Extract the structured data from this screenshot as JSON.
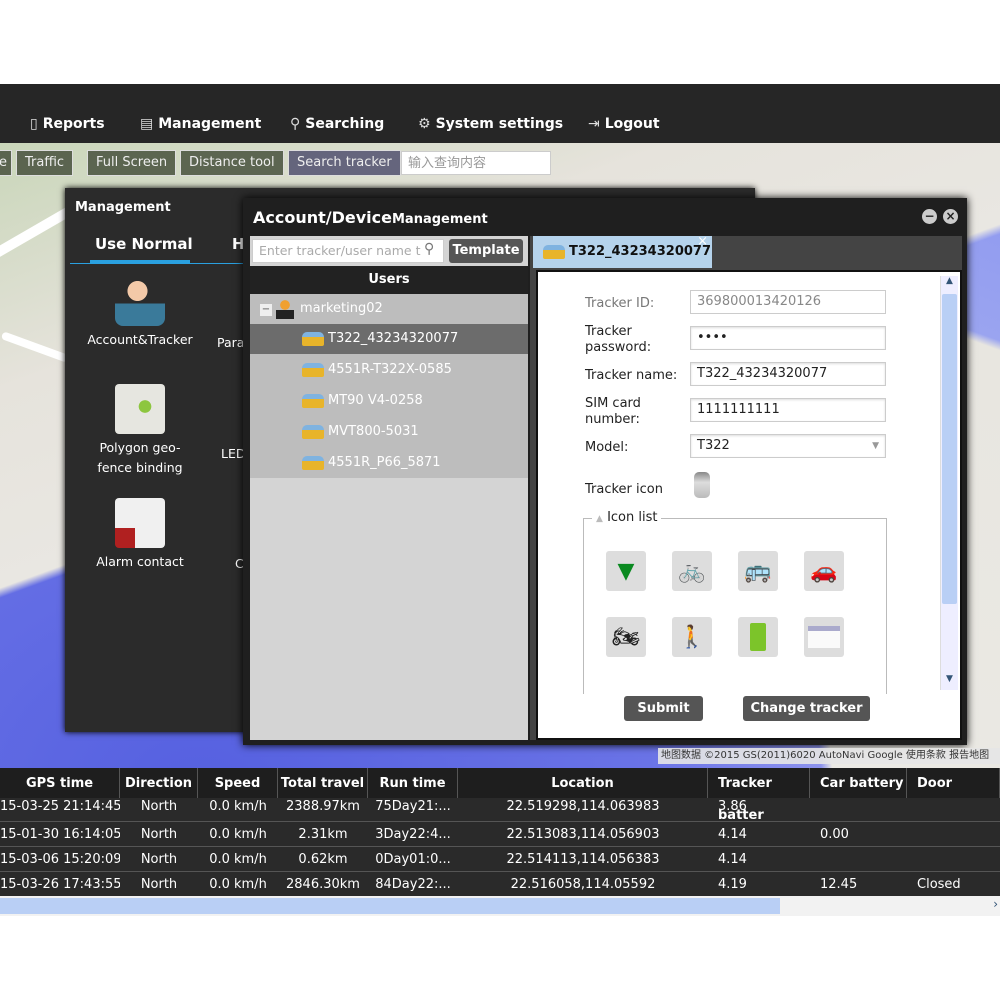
{
  "nav": {
    "items": [
      {
        "icon": "clipboard-icon",
        "label": "Reports"
      },
      {
        "icon": "management-icon",
        "label": "Management"
      },
      {
        "icon": "search-icon",
        "label": "Searching"
      },
      {
        "icon": "gear-icon",
        "label": "System settings"
      },
      {
        "icon": "logout-icon",
        "label": "Logout"
      }
    ]
  },
  "map_toolbar": {
    "partial": "e",
    "traffic": "Traffic",
    "full_screen": "Full Screen",
    "distance_tool": "Distance tool",
    "search_tracker": "Search tracker",
    "search_placeholder": "输入查询内容"
  },
  "management": {
    "title": "Management",
    "tabs": [
      "Use Normal",
      "H"
    ],
    "items": [
      {
        "label": "Account&Tracker",
        "icon": "account-tracker-icon"
      },
      {
        "label": "Polygon geo-fence binding",
        "icon": "geofence-icon"
      },
      {
        "label": "Alarm contact",
        "icon": "alarm-contact-icon"
      }
    ],
    "col2_partial": [
      "Para",
      "LED",
      "C"
    ]
  },
  "dialog": {
    "title_main": "Account/Device",
    "title_sub": "Management",
    "search_placeholder": "Enter tracker/user name t",
    "template_label": "Template",
    "users_header": "Users",
    "tree": {
      "user": "marketing02",
      "devices": [
        "T322_43234320077",
        "4551R-T322X-0585",
        "MT90 V4-0258",
        "MVT800-5031",
        "4551R_P66_5871"
      ],
      "selected": 0
    },
    "tab": "T322_43234320077",
    "form": {
      "tracker_id_label": "Tracker ID:",
      "tracker_id": "369800013420126",
      "password_label": "Tracker password:",
      "password": "••••",
      "name_label": "Tracker name:",
      "name": "T322_43234320077",
      "sim_label": "SIM card number:",
      "sim": "1111111111",
      "model_label": "Model:",
      "model": "T322",
      "icon_label": "Tracker icon",
      "icon_list_label": "Icon list",
      "icons": [
        "arrow-icon",
        "bicycle-icon",
        "bus-icon",
        "car-icon",
        "motorcycle-icon",
        "person-icon",
        "battery-icon",
        "car-battery-icon"
      ]
    },
    "submit": "Submit",
    "change_id": "Change tracker ID"
  },
  "map_attribution": "地图数据 ©2015 GS(2011)6020 AutoNavi Google   使用条款   报告地图",
  "table": {
    "columns": [
      "GPS time",
      "Direction",
      "Speed",
      "Total travel",
      "Run time",
      "Location",
      "Tracker batter",
      "Car battery",
      "Door"
    ],
    "rows": [
      [
        "15-03-25 21:14:45",
        "North",
        "0.0 km/h",
        "2388.97km",
        "75Day21:...",
        "22.519298,114.063983",
        "3.86",
        "",
        ""
      ],
      [
        "15-01-30 16:14:05",
        "North",
        "0.0 km/h",
        "2.31km",
        "3Day22:4...",
        "22.513083,114.056903",
        "4.14",
        "0.00",
        ""
      ],
      [
        "15-03-06 15:20:09",
        "North",
        "0.0 km/h",
        "0.62km",
        "0Day01:0...",
        "22.514113,114.056383",
        "4.14",
        "",
        ""
      ],
      [
        "15-03-26 17:43:55",
        "North",
        "0.0 km/h",
        "2846.30km",
        "84Day22:...",
        "22.516058,114.05592",
        "4.19",
        "12.45",
        "Closed"
      ]
    ]
  }
}
